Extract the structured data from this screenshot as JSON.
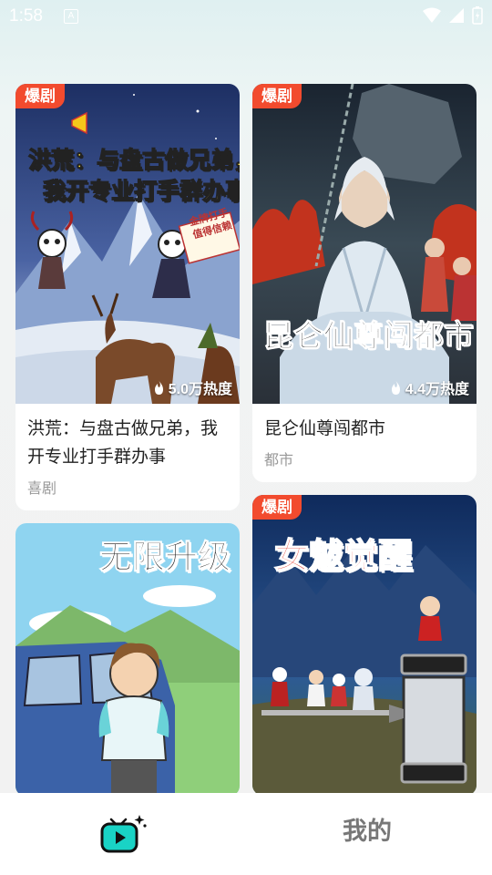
{
  "status_bar": {
    "time": "1:58",
    "a_icon": "A"
  },
  "feed": {
    "left": [
      {
        "badge": "爆剧",
        "cover_text": [
          "洪荒：与盘古做兄弟，",
          "我开专业打手群办事"
        ],
        "sign_text": [
          "金牌打手",
          "值得信赖"
        ],
        "heat": "5.0万热度",
        "title": "洪荒：与盘古做兄弟，我开专业打手群办事",
        "genre": "喜剧"
      },
      {
        "cover_text": "无限升级"
      }
    ],
    "right": [
      {
        "badge": "爆剧",
        "cover_text": "昆仑仙尊闯都市",
        "heat": "4.4万热度",
        "title": "昆仑仙尊闯都市",
        "genre": "都市"
      },
      {
        "badge": "爆剧",
        "cover_text": "女魃觉醒"
      }
    ]
  },
  "bottom_nav": {
    "home_icon": "tv-play-icon",
    "mine_label": "我的"
  },
  "colors": {
    "badge": "#f24b2e",
    "accent": "#19d3c5",
    "nav_text": "#777777"
  }
}
